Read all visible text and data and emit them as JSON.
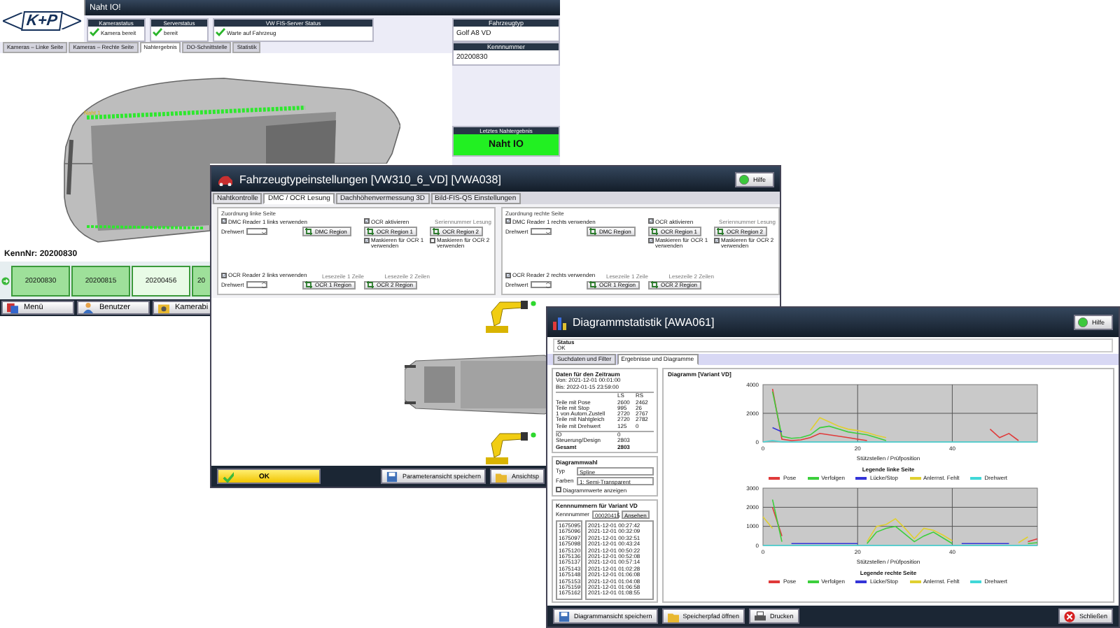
{
  "main_window": {
    "logo_text": "K+P",
    "title": "Naht IO!",
    "status_panels": [
      {
        "label": "Kamerastatus",
        "value": "Kamera bereit",
        "ok": true
      },
      {
        "label": "Serverstatus",
        "value": "bereit",
        "ok": true
      },
      {
        "label": "VW FIS-Server Status",
        "value": "Warte auf Fahrzeug",
        "ok": true
      }
    ],
    "tabs": [
      {
        "label": "Kameras – Linke Seite",
        "selected": false
      },
      {
        "label": "Kameras – Rechte Seite",
        "selected": false
      },
      {
        "label": "Nahtergebnis",
        "selected": true
      },
      {
        "label": "DO-Schnittstelle",
        "selected": false
      },
      {
        "label": "Statistik",
        "selected": false
      }
    ],
    "side_panels": [
      {
        "label": "Fahrzeugtyp",
        "value": "Golf A8 VD"
      },
      {
        "label": "Kennnummer",
        "value": "20200830"
      }
    ],
    "last_result": {
      "label": "Letztes Nahtergebnis",
      "value": "Naht IO",
      "ok": true
    },
    "seam_label": "Naht 1",
    "id_caption": "KennNr:  20200830",
    "thumbnails": [
      {
        "label": "20200830",
        "selected": false
      },
      {
        "label": "20200815",
        "selected": false
      },
      {
        "label": "20200456",
        "selected": true
      },
      {
        "label": "20",
        "selected": false
      }
    ],
    "buttons": [
      {
        "label": "Menü",
        "kind": "menu"
      },
      {
        "label": "Benutzer",
        "kind": "user"
      },
      {
        "label": "Kamerabi",
        "kind": "camera"
      }
    ]
  },
  "settings_window": {
    "title": "Fahrzeugtypeinstellungen [VW310_6_VD]  [VWA038]",
    "help_button": "Hilfe",
    "tabs": [
      {
        "label": "Nahtkontrolle",
        "selected": false
      },
      {
        "label": "DMC / OCR Lesung",
        "selected": true
      },
      {
        "label": "Dachhöhenvermessung 3D",
        "selected": false
      },
      {
        "label": "Bild-FIS-QS Einstellungen",
        "selected": false
      }
    ],
    "groups": [
      {
        "title": "Zuordnung linke Seite",
        "rows": [
          [
            {
              "kind": "checkbox",
              "label": "DMC Reader 1 links verwenden",
              "checked": true
            },
            null,
            {
              "kind": "checkbox",
              "label": "OCR aktivieren",
              "checked": true
            },
            {
              "kind": "caption",
              "label": "Seriennummer Lesung"
            }
          ],
          [
            {
              "kind": "spinner",
              "label": "Drehwert"
            },
            {
              "kind": "region_button",
              "label": "DMC Region"
            },
            {
              "kind": "region_button",
              "label": "OCR Region 1"
            },
            {
              "kind": "region_button",
              "label": "OCR Region 2"
            }
          ],
          [
            null,
            null,
            {
              "kind": "checkbox",
              "label": "Maskieren für OCR 1 verwenden",
              "checked": true
            },
            {
              "kind": "checkbox",
              "label": "Maskieren für OCR 2 verwenden",
              "checked": false
            }
          ],
          [
            {
              "kind": "checkbox",
              "label": "OCR Reader 2 links verwenden",
              "checked": true
            },
            {
              "kind": "caption",
              "label": "Lesezeile 1 Zeile"
            },
            {
              "kind": "caption",
              "label": "Lesezeile 2 Zeilen"
            },
            null
          ],
          [
            {
              "kind": "spinner",
              "label": "Drehwert"
            },
            {
              "kind": "region_button",
              "label": "OCR 1 Region"
            },
            {
              "kind": "region_button",
              "label": "OCR 2 Region"
            },
            null
          ]
        ]
      },
      {
        "title": "Zuordnung rechte Seite",
        "rows": [
          [
            {
              "kind": "checkbox",
              "label": "DMC Reader 1 rechts verwenden",
              "checked": true
            },
            null,
            {
              "kind": "checkbox",
              "label": "OCR aktivieren",
              "checked": true
            },
            {
              "kind": "caption",
              "label": "Seriennummer Lesung"
            }
          ],
          [
            {
              "kind": "spinner",
              "label": "Drehwert"
            },
            {
              "kind": "region_button",
              "label": "DMC Region"
            },
            {
              "kind": "region_button",
              "label": "OCR Region 1"
            },
            {
              "kind": "region_button",
              "label": "OCR Region 2"
            }
          ],
          [
            null,
            null,
            {
              "kind": "checkbox",
              "label": "Maskieren für OCR 1 verwenden",
              "checked": true
            },
            {
              "kind": "checkbox",
              "label": "Maskieren für OCR 2 verwenden",
              "checked": true
            }
          ],
          [
            {
              "kind": "checkbox",
              "label": "OCR Reader 2 rechts verwenden",
              "checked": true
            },
            {
              "kind": "caption",
              "label": "Lesezeile 1 Zeile"
            },
            {
              "kind": "caption",
              "label": "Lesezeile 2 Zeilen"
            },
            null
          ],
          [
            {
              "kind": "spinner",
              "label": "Drehwert"
            },
            {
              "kind": "region_button",
              "label": "OCR 1 Region"
            },
            {
              "kind": "region_button",
              "label": "OCR 2 Region"
            },
            null
          ]
        ]
      }
    ],
    "buttons": [
      {
        "label": "OK",
        "kind": "ok"
      },
      {
        "label": "Parameteransicht speichern",
        "kind": "save"
      },
      {
        "label": "Ansichtsp",
        "kind": "folder"
      }
    ]
  },
  "stats_window": {
    "title": "Diagrammstatistik  [AWA061]",
    "help_button": "Hilfe",
    "status_label": "Status",
    "status_value": "OK",
    "tabs": [
      {
        "label": "Suchdaten und Filter",
        "selected": false
      },
      {
        "label": "Ergebnisse und Diagramme",
        "selected": true
      }
    ],
    "period": {
      "title": "Daten für den Zeitraum",
      "from": "Von:  2021-12-01 00:01:00",
      "to": "Bis:  2022-01-15 23:59:00",
      "columns": [
        "LS",
        "RS"
      ],
      "rows": [
        {
          "label": "Teile mit Pose",
          "values": [
            "2600",
            "2462"
          ]
        },
        {
          "label": "Teile mit Stop",
          "values": [
            "995",
            "26"
          ]
        },
        {
          "label": "1 von Autom.Zustell",
          "values": [
            "2720",
            "2767"
          ]
        },
        {
          "label": "Teile mit Nahtgleich",
          "values": [
            "2720",
            "2782"
          ]
        },
        {
          "label": "Teile mit Drehwert",
          "values": [
            "125",
            "0"
          ]
        }
      ],
      "totals": [
        {
          "label": "IO",
          "value": "0",
          "bold": false
        },
        {
          "label": "Steuerung/Design",
          "value": "2803",
          "bold": false
        },
        {
          "label": "Gesamt",
          "value": "2803",
          "bold": true
        }
      ]
    },
    "diagram_options": {
      "title": "Diagrammwahl",
      "fields": [
        {
          "label": "Typ",
          "value": "Spline"
        },
        {
          "label": "Farben",
          "value": "1: Semi-Transparent"
        }
      ],
      "show_values": {
        "label": "Diagrammwerte anzeigen",
        "checked": false
      }
    },
    "id_list": {
      "title": "Kennnummern für Variant VD",
      "field_label": "Kennnummer",
      "field_value": "00020415",
      "button": "Ansehen",
      "ids": [
        "1675095",
        "1675096",
        "1675097",
        "1675098",
        "1675120",
        "1675136",
        "1675137",
        "1675143",
        "1675148",
        "1675153",
        "1675159",
        "1675162"
      ],
      "times": [
        "2021-12-01 00:27:42",
        "2021-12-01 00:32:09",
        "2021-12-01 00:32:51",
        "2021-12-01 00:43:24",
        "2021-12-01 00:50:22",
        "2021-12-01 00:52:08",
        "2021-12-01 00:57:14",
        "2021-12-01 01:02:28",
        "2021-12-01 01:06:08",
        "2021-12-01 01:04:08",
        "2021-12-01 01:06:58",
        "2021-12-01 01:08:55"
      ]
    },
    "diagram_title": "Diagramm  [Variant VD]",
    "charts": [
      {
        "legend_title": "Legende linke Seite",
        "chart_data": {
          "type": "line",
          "xlabel": "Stützstellen / Prüfposition",
          "x": [
            0,
            2,
            4,
            6,
            8,
            10,
            12,
            14,
            16,
            18,
            20,
            22,
            24,
            26,
            28,
            30,
            32,
            34,
            36,
            38,
            40,
            42,
            44,
            46,
            48,
            50,
            52,
            54,
            56,
            58
          ],
          "xlim": [
            0,
            58
          ],
          "ylim": [
            0,
            4000
          ],
          "xticks": [
            0,
            20,
            40
          ],
          "yticks": [
            0,
            2000,
            4000
          ],
          "grid": true,
          "legend": "bottom",
          "series": [
            {
              "name": "Pose",
              "color": "#e03a3a",
              "values": [
                null,
                3700,
                200,
                100,
                150,
                300,
                600,
                500,
                400,
                300,
                200,
                100,
                null,
                null,
                null,
                null,
                null,
                null,
                null,
                null,
                null,
                null,
                null,
                null,
                900,
                300,
                600,
                100,
                null,
                null
              ]
            },
            {
              "name": "Verfolgen",
              "color": "#3ccf3c",
              "values": [
                null,
                3500,
                400,
                250,
                300,
                500,
                1000,
                1100,
                900,
                700,
                600,
                500,
                300,
                100,
                null,
                null,
                null,
                null,
                null,
                null,
                null,
                null,
                null,
                null,
                null,
                null,
                null,
                null,
                null,
                null
              ]
            },
            {
              "name": "Lücke/Stop",
              "color": "#3434d8",
              "values": [
                null,
                1000,
                700,
                null,
                null,
                null,
                null,
                null,
                null,
                null,
                null,
                null,
                null,
                null,
                null,
                null,
                null,
                null,
                null,
                null,
                null,
                null,
                null,
                null,
                null,
                null,
                null,
                null,
                null,
                null
              ]
            },
            {
              "name": "Anlernst. Fehlt",
              "color": "#e0d030",
              "values": [
                null,
                null,
                null,
                null,
                null,
                800,
                1700,
                1400,
                1100,
                900,
                800,
                650,
                450,
                300,
                null,
                null,
                null,
                null,
                null,
                null,
                null,
                null,
                null,
                null,
                null,
                null,
                null,
                null,
                null,
                null
              ]
            },
            {
              "name": "Drehwert",
              "color": "#40d8d8",
              "values": [
                0,
                100,
                0,
                0,
                0,
                0,
                0,
                0,
                0,
                0,
                0,
                0,
                0,
                0,
                0,
                0,
                0,
                0,
                0,
                0,
                0,
                0,
                0,
                0,
                0,
                0,
                0,
                0,
                0,
                0
              ]
            }
          ]
        }
      },
      {
        "legend_title": "Legende rechte Seite",
        "chart_data": {
          "type": "line",
          "xlabel": "Stützstellen / Prüfposition",
          "x": [
            0,
            2,
            4,
            6,
            8,
            10,
            12,
            14,
            16,
            18,
            20,
            22,
            24,
            26,
            28,
            30,
            32,
            34,
            36,
            38,
            40,
            42,
            44,
            46,
            48,
            50,
            52,
            54,
            56,
            58
          ],
          "xlim": [
            0,
            58
          ],
          "ylim": [
            0,
            3000
          ],
          "xticks": [
            0,
            20,
            40
          ],
          "yticks": [
            0,
            1000,
            2000,
            3000
          ],
          "grid": true,
          "legend": "bottom",
          "series": [
            {
              "name": "Pose",
              "color": "#e03a3a",
              "values": [
                null,
                2000,
                500,
                null,
                null,
                null,
                null,
                null,
                null,
                null,
                null,
                null,
                null,
                null,
                null,
                null,
                null,
                null,
                null,
                null,
                null,
                null,
                null,
                null,
                null,
                null,
                null,
                null,
                200,
                350
              ]
            },
            {
              "name": "Verfolgen",
              "color": "#3ccf3c",
              "values": [
                null,
                2400,
                200,
                null,
                null,
                null,
                null,
                null,
                null,
                null,
                null,
                100,
                700,
                900,
                1000,
                600,
                200,
                500,
                700,
                400,
                100,
                null,
                null,
                null,
                null,
                null,
                null,
                null,
                100,
                150
              ]
            },
            {
              "name": "Lücke/Stop",
              "color": "#3434d8",
              "values": [
                null,
                null,
                null,
                100,
                100,
                100,
                100,
                100,
                100,
                100,
                100,
                null,
                null,
                null,
                null,
                null,
                null,
                null,
                null,
                null,
                null,
                100,
                100,
                100,
                100,
                100,
                100,
                null,
                null,
                null
              ]
            },
            {
              "name": "Anlernst. Fehlt",
              "color": "#e0d030",
              "values": [
                1500,
                900,
                null,
                null,
                null,
                null,
                null,
                null,
                null,
                null,
                null,
                200,
                1000,
                1100,
                1400,
                900,
                350,
                900,
                800,
                550,
                250,
                null,
                null,
                null,
                null,
                null,
                null,
                150,
                450,
                null
              ]
            },
            {
              "name": "Drehwert",
              "color": "#40d8d8",
              "values": [
                0,
                0,
                0,
                0,
                0,
                0,
                0,
                0,
                0,
                0,
                0,
                0,
                0,
                0,
                0,
                0,
                0,
                0,
                0,
                0,
                0,
                0,
                0,
                0,
                0,
                0,
                0,
                0,
                0,
                0
              ]
            }
          ]
        }
      }
    ],
    "buttons": [
      {
        "label": "Diagrammansicht speichern",
        "kind": "save"
      },
      {
        "label": "Speicherpfad öffnen",
        "kind": "folder"
      },
      {
        "label": "Drucken",
        "kind": "print"
      },
      {
        "label": "Schließen",
        "kind": "close"
      }
    ]
  }
}
